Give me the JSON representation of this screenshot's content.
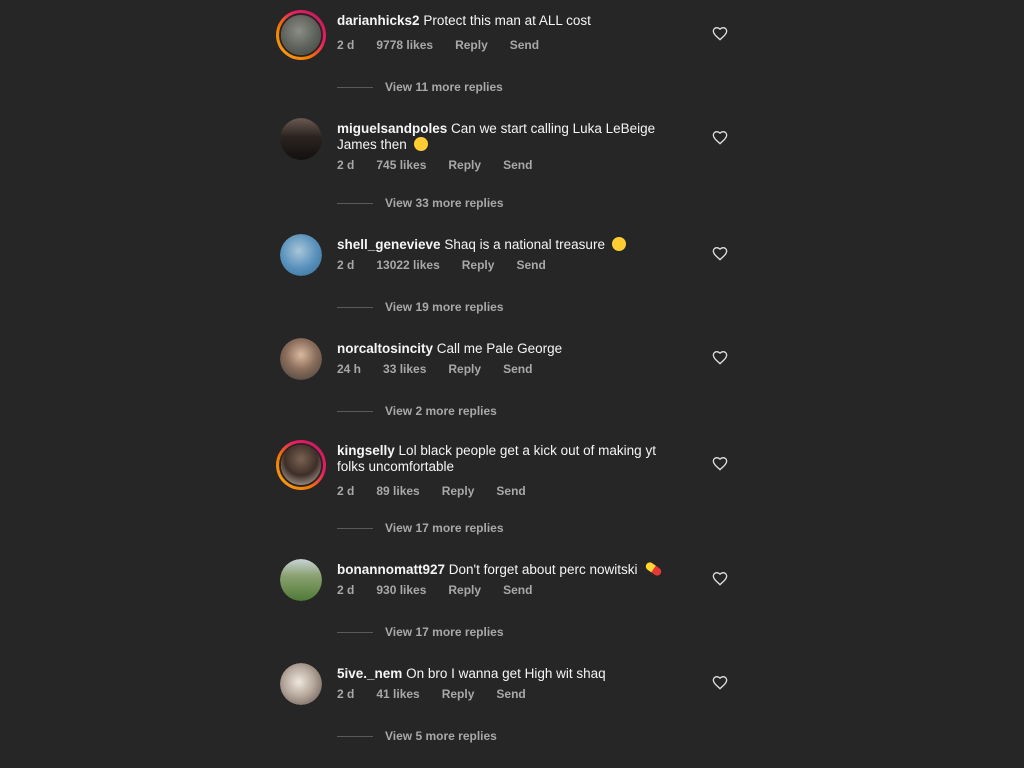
{
  "comments": [
    {
      "username": "darianhicks2",
      "text": "Protect this man at ALL cost",
      "time": "2 d",
      "likes": "9778 likes",
      "reply": "Reply",
      "send": "Send",
      "more_replies": "View 11 more replies",
      "has_story": true,
      "avatar_color": "#6b6f68"
    },
    {
      "username": "miguelsandpoles",
      "text": "Can we start calling Luka LeBeige James then",
      "time": "2 d",
      "likes": "745 likes",
      "reply": "Reply",
      "send": "Send",
      "more_replies": "View 33 more replies",
      "has_story": false,
      "avatar_color": "#3a2f2b"
    },
    {
      "username": "shell_genevieve",
      "text": "Shaq is a national treasure",
      "time": "2 d",
      "likes": "13022 likes",
      "reply": "Reply",
      "send": "Send",
      "more_replies": "View 19 more replies",
      "has_story": false,
      "avatar_color": "#4a86b3"
    },
    {
      "username": "norcaltosincity",
      "text": "Call me Pale George",
      "time": "24 h",
      "likes": "33 likes",
      "reply": "Reply",
      "send": "Send",
      "more_replies": "View 2 more replies",
      "has_story": false,
      "avatar_color": "#8a7a6c"
    },
    {
      "username": "kingselly",
      "text": "Lol black people get a kick out of making yt folks uncomfortable",
      "time": "2 d",
      "likes": "89 likes",
      "reply": "Reply",
      "send": "Send",
      "more_replies": "View 17 more replies",
      "has_story": true,
      "avatar_color": "#5b4a3f"
    },
    {
      "username": "bonannomatt927",
      "text": "Don't forget about perc nowitski",
      "time": "2 d",
      "likes": "930 likes",
      "reply": "Reply",
      "send": "Send",
      "more_replies": "View 17 more replies",
      "has_story": false,
      "avatar_color": "#5d7a45"
    },
    {
      "username": "5ive._nem",
      "text": "On bro I wanna get High wit shaq",
      "time": "2 d",
      "likes": "41 likes",
      "reply": "Reply",
      "send": "Send",
      "more_replies": "View 5 more replies",
      "has_story": false,
      "avatar_color": "#b6aaa0"
    }
  ],
  "icons": {
    "like": "heart-outline-icon",
    "laugh_emoji": "grinning-squinting-face",
    "pill_emoji": "pill"
  },
  "colors": {
    "background": "#262626",
    "primary_text": "#f5f5f5",
    "secondary_text": "#a8a8a8",
    "story_ring_start": "#f9a825",
    "story_ring_end": "#c2185b"
  }
}
